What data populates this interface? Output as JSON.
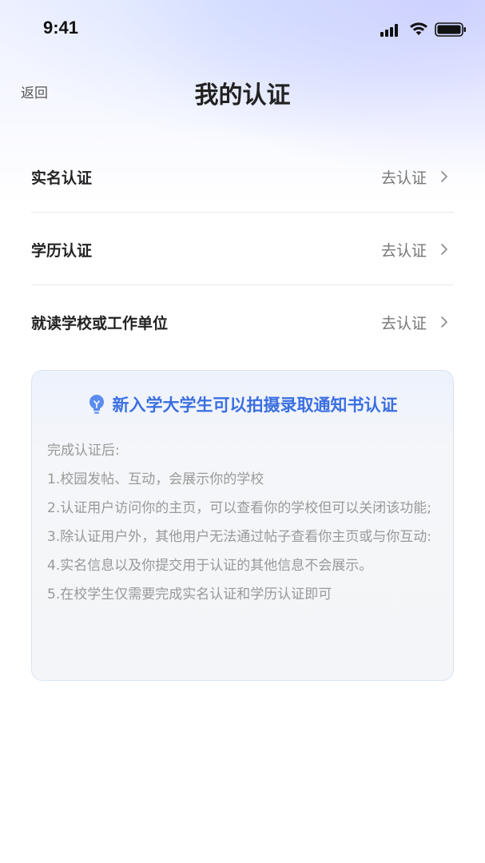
{
  "status_bar": {
    "time": "9:41",
    "icons": [
      "signal-icon",
      "wifi-icon",
      "battery-icon"
    ]
  },
  "nav": {
    "back_label": "返回",
    "title": "我的认证"
  },
  "cert_items": [
    {
      "label": "实名认证",
      "action": "去认证"
    },
    {
      "label": "学历认证",
      "action": "去认证"
    },
    {
      "label": "就读学校或工作单位",
      "action": "去认证"
    }
  ],
  "notice": {
    "icon": "lightbulb-icon",
    "title": "新入学大学生可以拍摄录取通知书认证",
    "lines": [
      "完成认证后:",
      "1.校园发帖、互动，会展示你的学校",
      "2.认证用户访问你的主页，可以查看你的学校但可以关闭该功能;",
      "3.除认证用户外，其他用户无法通过帖子查看你主页或与你互动:",
      "4.实名信息以及你提交用于认证的其他信息不会展示。",
      "5.在校学生仅需要完成实名认证和学历认证即可"
    ]
  },
  "colors": {
    "accent": "#3b6fe0",
    "text_primary": "#222222",
    "text_secondary": "#777777",
    "notice_text": "#999999",
    "divider": "#e9e9ee"
  }
}
